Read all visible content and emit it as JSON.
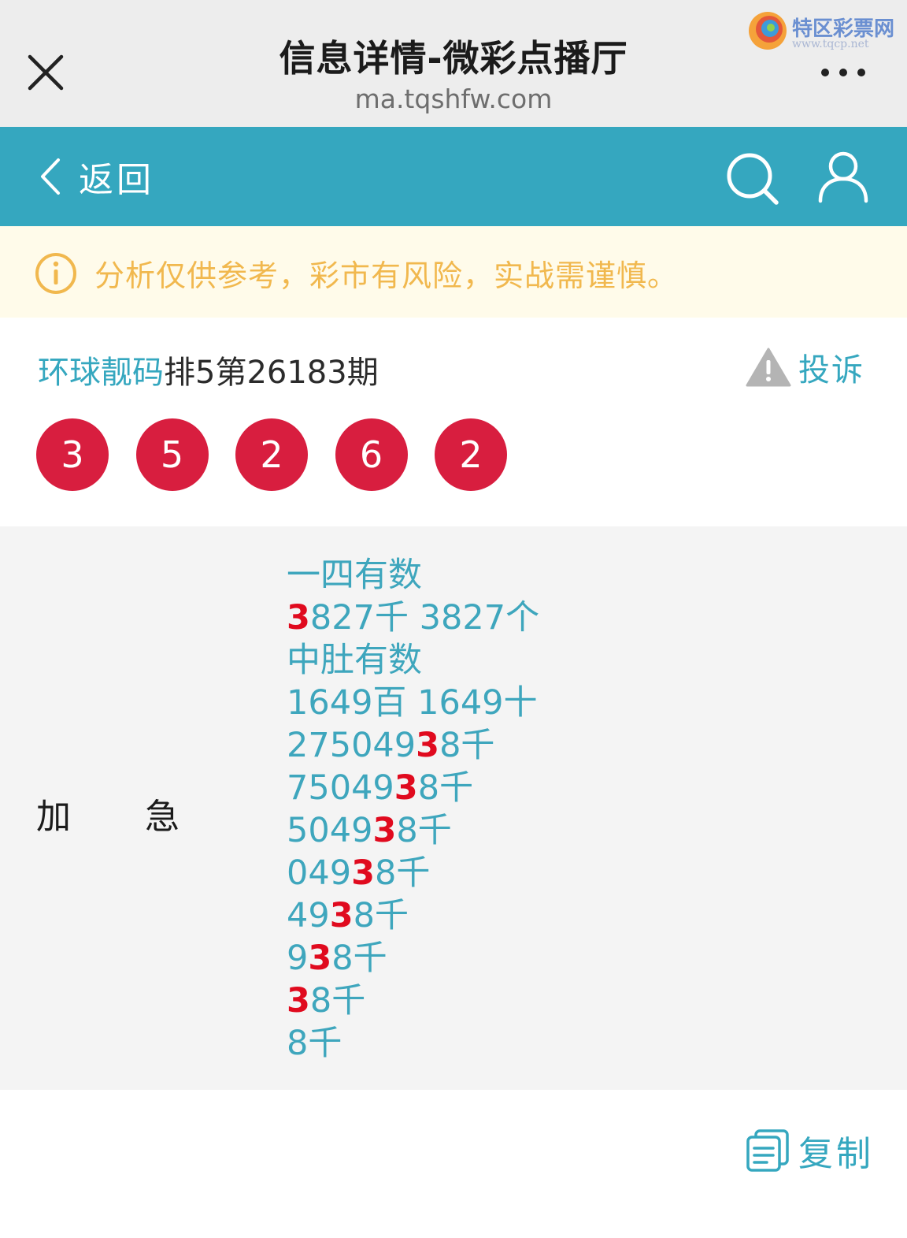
{
  "browser": {
    "title": "信息详情-微彩点播厅",
    "domain": "ma.tqshfw.com",
    "watermark_main": "特区彩票网",
    "watermark_sub": "www.tqcp.net"
  },
  "nav": {
    "back_label": "返回"
  },
  "notice": {
    "text": "分析仅供参考，彩市有风险，实战需谨慎。",
    "color": "#f1b84e"
  },
  "post": {
    "brand": "环球靓码",
    "title_rest": "排5第26183期",
    "complain_label": "投诉"
  },
  "balls": [
    "3",
    "5",
    "2",
    "6",
    "2"
  ],
  "content": {
    "label_left": "加",
    "label_right": "急",
    "lines": [
      {
        "pre": "一四有数",
        "hl": "",
        "post": ""
      },
      {
        "pre": "",
        "hl": "3",
        "post": "827千 3827个"
      },
      {
        "pre": "中肚有数",
        "hl": "",
        "post": ""
      },
      {
        "pre": "1649百 1649十",
        "hl": "",
        "post": ""
      },
      {
        "pre": "275049",
        "hl": "3",
        "post": "8千"
      },
      {
        "pre": "75049",
        "hl": "3",
        "post": "8千"
      },
      {
        "pre": "5049",
        "hl": "3",
        "post": "8千"
      },
      {
        "pre": "049",
        "hl": "3",
        "post": "8千"
      },
      {
        "pre": "49",
        "hl": "3",
        "post": "8千"
      },
      {
        "pre": "9",
        "hl": "3",
        "post": "8千"
      },
      {
        "pre": "",
        "hl": "3",
        "post": "8千"
      },
      {
        "pre": "8千",
        "hl": "",
        "post": ""
      }
    ]
  },
  "actions": {
    "copy_label": "复制"
  },
  "colors": {
    "accent": "#35a7bf",
    "ball": "#d81e3f",
    "highlight": "#e00a1e"
  }
}
